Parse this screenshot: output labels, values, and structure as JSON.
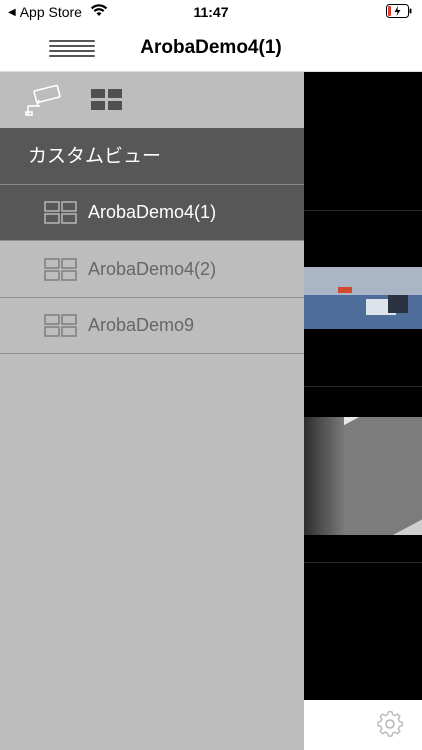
{
  "status_bar": {
    "back_app": "App Store",
    "time": "11:47"
  },
  "nav": {
    "title": "ArobaDemo4(1)"
  },
  "drawer": {
    "header": "カスタムビュー",
    "items": [
      {
        "label": "ArobaDemo4(1)",
        "selected": true
      },
      {
        "label": "ArobaDemo4(2)",
        "selected": false
      },
      {
        "label": "ArobaDemo9",
        "selected": false
      }
    ]
  },
  "icons": {
    "camera": "camera-icon",
    "grid": "grid-view-icon",
    "settings": "gear-icon",
    "menu": "hamburger-menu-icon"
  },
  "colors": {
    "drawer_bg": "#bdbdbd",
    "selected_bg": "#575757",
    "header_bg": "#575757"
  }
}
